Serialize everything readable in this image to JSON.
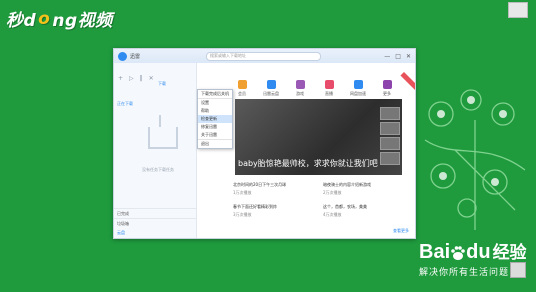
{
  "watermark": {
    "logo_text_a": "秒d",
    "logo_text_o": "o",
    "logo_text_b": "ng视频"
  },
  "window": {
    "title": "迅雷",
    "address_placeholder": "搜索或输入下载地址",
    "controls": [
      "—",
      "□",
      "✕"
    ]
  },
  "sidebar": {
    "tab_download": "下载",
    "note": "正在下载",
    "empty_text": "没有任务下载任务",
    "footer_items": [
      "已完成",
      "垃圾箱"
    ],
    "bottom_link": "云盘"
  },
  "menu": {
    "items": [
      {
        "label": "下载完成后关机"
      },
      {
        "label": "设置"
      },
      {
        "label": "帮助"
      },
      {
        "label": "检查更新"
      },
      {
        "label": "修复迅雷"
      },
      {
        "label": "关于迅雷"
      },
      {
        "label": "退出"
      }
    ],
    "active_index": 3
  },
  "apps": [
    {
      "label": "会员",
      "color": "#f0a030"
    },
    {
      "label": "迅雷云盘",
      "color": "#2f8bf0"
    },
    {
      "label": "游戏",
      "color": "#9b59b6"
    },
    {
      "label": "直播",
      "color": "#e84c6b"
    },
    {
      "label": "网盘加速",
      "color": "#2f8bf0"
    },
    {
      "label": "更多",
      "color": "#8e44ad"
    }
  ],
  "banner": {
    "title": "baby胎惊艳最帅校，求求你就让我们吧"
  },
  "news": [
    {
      "title": "北京时间的20日下午三次月球",
      "meta": "1万次播放"
    },
    {
      "title": "暗夜骑士的内容介绍新游戏",
      "meta": "2万次播放"
    },
    {
      "title": "春节下面还好看精彩到炸",
      "meta": "3万次播放"
    },
    {
      "title": "这个，首都，农场，美美",
      "meta": "4万次播放"
    }
  ],
  "more_link": "查看更多",
  "brand": {
    "name": "Bai",
    "paw": "du",
    "jy": "经验",
    "slogan": "解决你所有生活问题"
  }
}
